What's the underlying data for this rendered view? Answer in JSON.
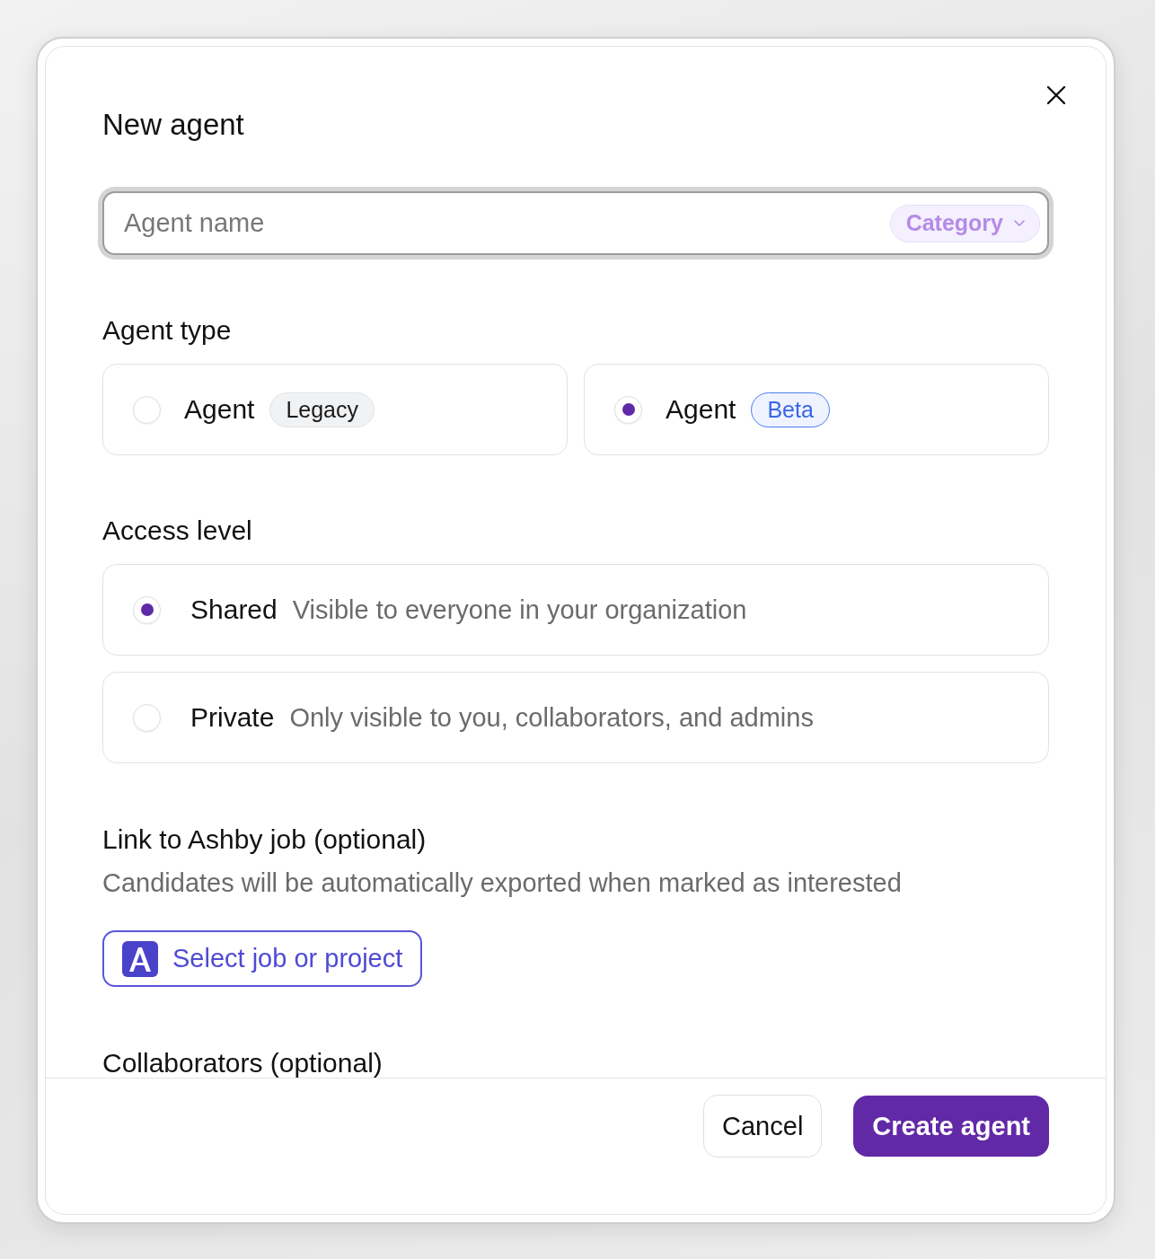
{
  "dialog": {
    "title": "New agent"
  },
  "name_field": {
    "placeholder": "Agent name",
    "category": "Category"
  },
  "agent_type": {
    "label": "Agent type",
    "options": [
      {
        "label": "Agent",
        "badge": "Legacy",
        "kind": "legacy",
        "selected": false
      },
      {
        "label": "Agent",
        "badge": "Beta",
        "kind": "beta",
        "selected": true
      }
    ]
  },
  "access_level": {
    "label": "Access level",
    "options": [
      {
        "label": "Shared",
        "description": "Visible to everyone in your organization",
        "selected": true
      },
      {
        "label": "Private",
        "description": "Only visible to you, collaborators, and admins",
        "selected": false
      }
    ]
  },
  "ashby_link": {
    "label": "Link to Ashby job (optional)",
    "description": "Candidates will be automatically exported when marked as interested",
    "button": "Select job or project"
  },
  "collaborators": {
    "label": "Collaborators (optional)"
  },
  "footer": {
    "buttons": [
      {
        "label": "Cancel",
        "kind": "secondary"
      },
      {
        "label": "Create agent",
        "kind": "primary"
      }
    ]
  }
}
